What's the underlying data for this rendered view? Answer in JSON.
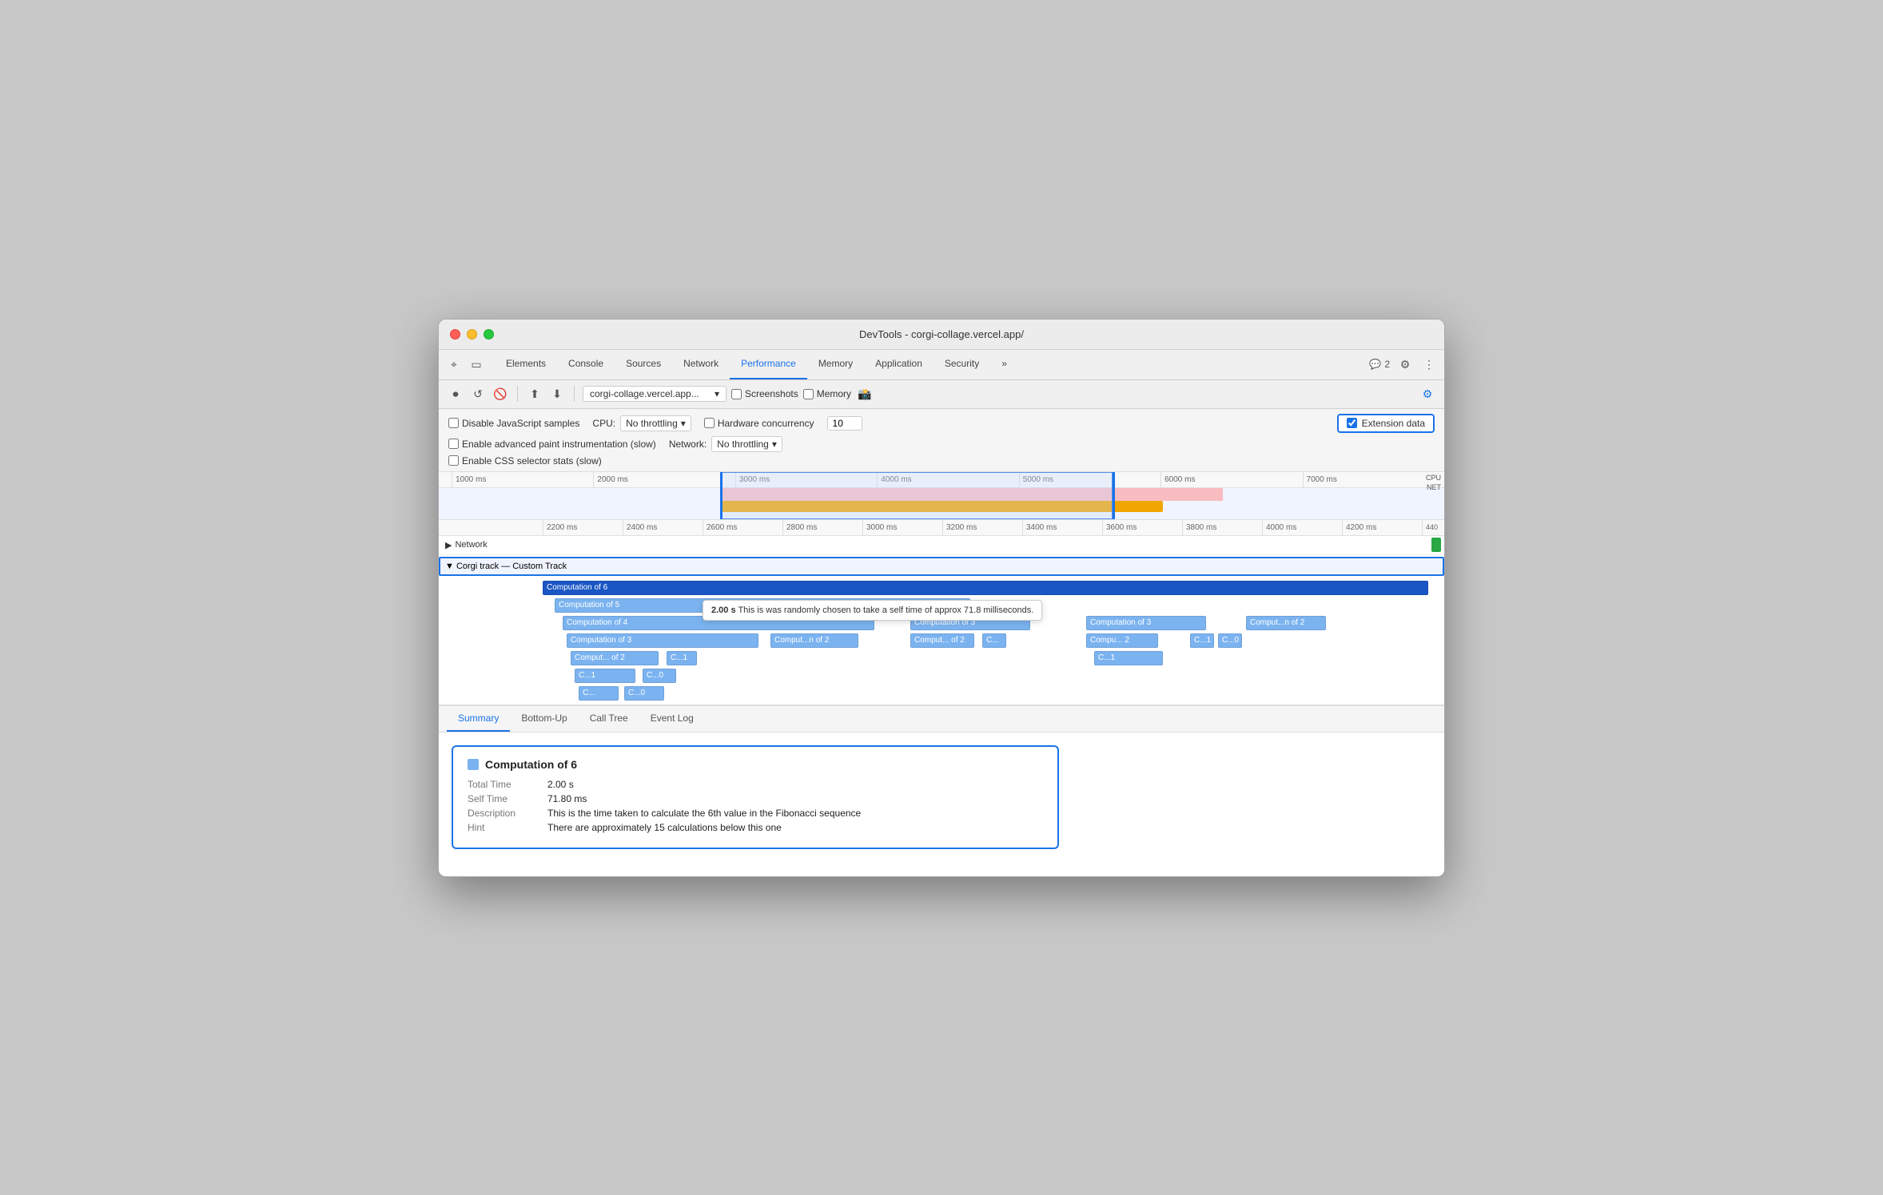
{
  "window": {
    "title": "DevTools - corgi-collage.vercel.app/"
  },
  "titlebar": {
    "buttons": [
      "close",
      "minimize",
      "maximize"
    ]
  },
  "tabs": {
    "items": [
      {
        "label": "Elements",
        "active": false
      },
      {
        "label": "Console",
        "active": false
      },
      {
        "label": "Sources",
        "active": false
      },
      {
        "label": "Network",
        "active": false
      },
      {
        "label": "Performance",
        "active": true
      },
      {
        "label": "Memory",
        "active": false
      },
      {
        "label": "Application",
        "active": false
      },
      {
        "label": "Security",
        "active": false
      },
      {
        "label": "»",
        "active": false
      }
    ],
    "badge_count": "2"
  },
  "toolbar": {
    "url": "corgi-collage.vercel.app...",
    "screenshots_label": "Screenshots",
    "memory_label": "Memory"
  },
  "options": {
    "disable_js_label": "Disable JavaScript samples",
    "advanced_paint_label": "Enable advanced paint instrumentation (slow)",
    "css_selector_label": "Enable CSS selector stats (slow)",
    "cpu_label": "CPU:",
    "cpu_throttle": "No throttling",
    "network_label": "Network:",
    "network_throttle": "No throttling",
    "hw_label": "Hardware concurrency",
    "hw_value": "10",
    "ext_data_label": "Extension data"
  },
  "timeline_ruler_top": {
    "ticks": [
      "1000 ms",
      "2000 ms",
      "3000 ms",
      "4000 ms",
      "5000 ms",
      "6000 ms",
      "7000 ms"
    ]
  },
  "timeline_ruler_main": {
    "ticks": [
      "2200 ms",
      "2400 ms",
      "2600 ms",
      "2800 ms",
      "3000 ms",
      "3200 ms",
      "3400 ms",
      "3600 ms",
      "3800 ms",
      "4000 ms",
      "4200 ms",
      "440"
    ]
  },
  "tracks": {
    "network_label": "Network",
    "corgi_label": "▼ Corgi track — Custom Track"
  },
  "flame": {
    "tooltip": {
      "time": "2.00 s",
      "text": "This is was randomly chosen to take a self time of approx 71.8 milliseconds."
    },
    "bars": [
      {
        "label": "Computation of 6",
        "level": 0,
        "left_pct": 0,
        "width_pct": 100,
        "selected": true
      },
      {
        "label": "Computation of 5",
        "level": 1,
        "left_pct": 2,
        "width_pct": 60
      },
      {
        "label": "Computation of 4",
        "level": 2,
        "left_pct": 3,
        "width_pct": 45
      },
      {
        "label": "Computation of 3",
        "level": 3,
        "left_pct": 4,
        "width_pct": 28
      },
      {
        "label": "Comput...n of 2",
        "level": 3,
        "left_pct": 34,
        "width_pct": 14
      },
      {
        "label": "Comput... of 2",
        "level": 4,
        "left_pct": 4,
        "width_pct": 13
      },
      {
        "label": "C...1",
        "level": 4,
        "left_pct": 18,
        "width_pct": 5
      },
      {
        "label": "C...1",
        "level": 5,
        "left_pct": 4,
        "width_pct": 9
      },
      {
        "label": "C...0",
        "level": 5,
        "left_pct": 15,
        "width_pct": 5
      },
      {
        "label": "C...",
        "level": 5,
        "left_pct": 21,
        "width_pct": 5
      },
      {
        "label": "C...",
        "level": 6,
        "left_pct": 4,
        "width_pct": 6
      },
      {
        "label": "C...0",
        "level": 6,
        "left_pct": 12,
        "width_pct": 6
      }
    ]
  },
  "bottom_tabs": {
    "items": [
      "Summary",
      "Bottom-Up",
      "Call Tree",
      "Event Log"
    ],
    "active": "Summary"
  },
  "summary": {
    "title": "Computation of 6",
    "total_time_label": "Total Time",
    "total_time_value": "2.00 s",
    "self_time_label": "Self Time",
    "self_time_value": "71.80 ms",
    "description_label": "Description",
    "description_value": "This is the time taken to calculate the 6th value in the Fibonacci sequence",
    "hint_label": "Hint",
    "hint_value": "There are approximately 15 calculations below this one"
  }
}
